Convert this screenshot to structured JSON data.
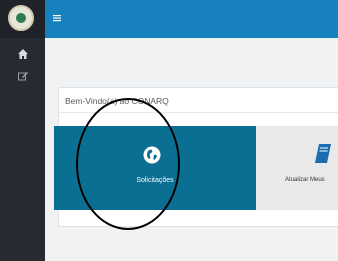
{
  "sidebar": {
    "logo_icon": "emblem-logo-icon",
    "items": [
      {
        "icon": "home-icon"
      },
      {
        "icon": "edit-icon"
      }
    ]
  },
  "topbar": {
    "menu_icon": "hamburger-menu-icon",
    "color": "#1681bd"
  },
  "main": {
    "welcome_text": "Bem-Vindo(a) ao CONARQ",
    "tiles": [
      {
        "label": "Solicitações",
        "icon": "globe-icon",
        "color": "#0a6f92"
      },
      {
        "label": "Atualizar Meus",
        "icon": "book-icon",
        "color": "#e9e9e9"
      }
    ]
  }
}
